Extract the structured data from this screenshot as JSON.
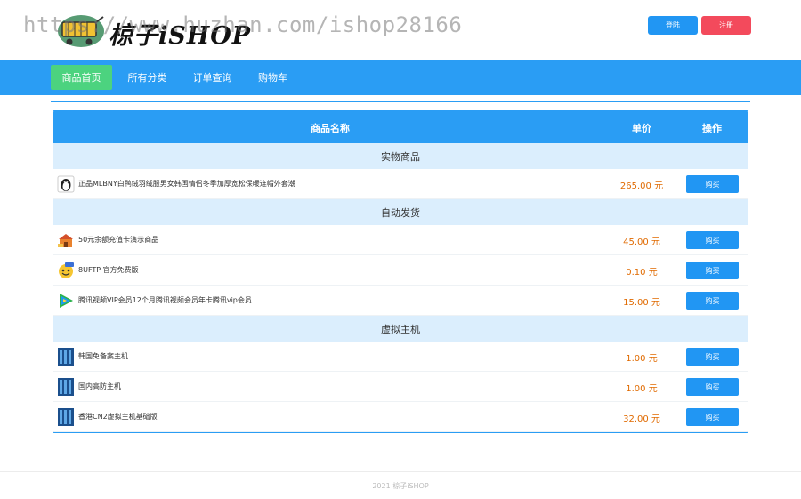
{
  "header": {
    "brand": "椋子iSHOP",
    "watermark": "https://www.huzhan.com/ishop28166",
    "login_label": "登陆",
    "register_label": "注册"
  },
  "nav": {
    "items": [
      {
        "label": "商品首页",
        "active": true
      },
      {
        "label": "所有分类",
        "active": false
      },
      {
        "label": "订单查询",
        "active": false
      },
      {
        "label": "购物车",
        "active": false
      }
    ]
  },
  "table": {
    "headers": {
      "name": "商品名称",
      "price": "单价",
      "action": "操作"
    },
    "categories": [
      {
        "title": "实物商品",
        "items": [
          {
            "name": "正品MLBNY白鸭绒羽绒服男女韩国情侣冬季加厚宽松保暖连帽外套潮",
            "price": "265.00 元",
            "icon": "penguin-icon"
          }
        ]
      },
      {
        "title": "自动发货",
        "items": [
          {
            "name": "50元余额充值卡演示商品",
            "price": "45.00 元",
            "icon": "shop-icon"
          },
          {
            "name": "8UFTP 官方免费版",
            "price": "0.10 元",
            "icon": "ftp-icon"
          },
          {
            "name": "腾讯视频VIP会员12个月腾讯视频会员年卡腾讯vip会员",
            "price": "15.00 元",
            "icon": "tencent-video-icon"
          }
        ]
      },
      {
        "title": "虚拟主机",
        "items": [
          {
            "name": "韩国免备案主机",
            "price": "1.00 元",
            "icon": "server-icon"
          },
          {
            "name": "国内高防主机",
            "price": "1.00 元",
            "icon": "server-icon"
          },
          {
            "name": "香港CN2虚拟主机基础版",
            "price": "32.00 元",
            "icon": "server-icon"
          }
        ]
      }
    ],
    "buy_label": "购买"
  },
  "footer": {
    "text": "2021 椋子iSHOP"
  },
  "colors": {
    "primary": "#2a9df4",
    "active_nav": "#4cd37f",
    "register": "#f34a5c",
    "price": "#e06a00"
  }
}
